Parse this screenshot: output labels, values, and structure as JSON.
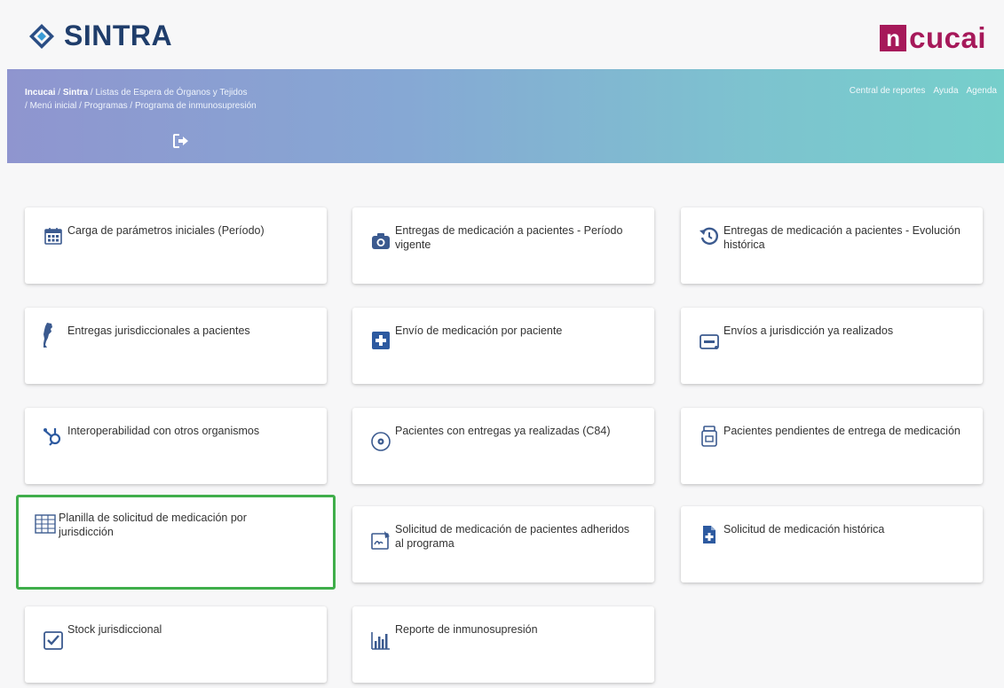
{
  "header": {
    "brand": "SINTRA",
    "partner_prefix": "n",
    "partner_name": "cucai"
  },
  "breadcrumb": {
    "items": [
      "Incucai",
      "Sintra",
      "Listas de Espera de Órganos y Tejidos",
      "Menú inicial",
      "Programas",
      "Programa de inmunosupresión"
    ]
  },
  "top_links": [
    "Central de reportes",
    "Ayuda",
    "Agenda"
  ],
  "cards": [
    {
      "label": "Carga de parámetros iniciales (Período)",
      "icon": "calendar-icon"
    },
    {
      "label": "Entregas de medicación a pacientes - Período vigente",
      "icon": "camera-icon"
    },
    {
      "label": "Entregas de medicación a pacientes - Evolución histórica",
      "icon": "history-icon"
    },
    {
      "label": "Entregas jurisdiccionales a pacientes",
      "icon": "argentina-map-icon"
    },
    {
      "label": "Envío de medicación por paciente",
      "icon": "medical-plus-icon"
    },
    {
      "label": "Envíos a jurisdicción ya realizados",
      "icon": "card-icon"
    },
    {
      "label": "Interoperabilidad con otros organismos",
      "icon": "hubspot-icon"
    },
    {
      "label": "Pacientes con entregas ya realizadas (C84)",
      "icon": "disc-icon"
    },
    {
      "label": "Pacientes pendientes de entrega de medicación",
      "icon": "prescription-bottle-icon"
    },
    {
      "label": "Planilla de solicitud de medicación por jurisdicción",
      "icon": "table-grid-icon",
      "selected": true
    },
    {
      "label": "Solicitud de medicación de pacientes adheridos al programa",
      "icon": "signature-icon"
    },
    {
      "label": "Solicitud de medicación histórica",
      "icon": "file-medical-icon"
    },
    {
      "label": "Stock jurisdiccional",
      "icon": "checkbox-icon"
    },
    {
      "label": "Reporte de inmunosupresión",
      "icon": "bar-chart-icon"
    }
  ],
  "colors": {
    "brand": "#1f3d6b",
    "partner": "#a6195a",
    "selected_border": "#3fae4a",
    "icon": "#3b5a8f"
  }
}
